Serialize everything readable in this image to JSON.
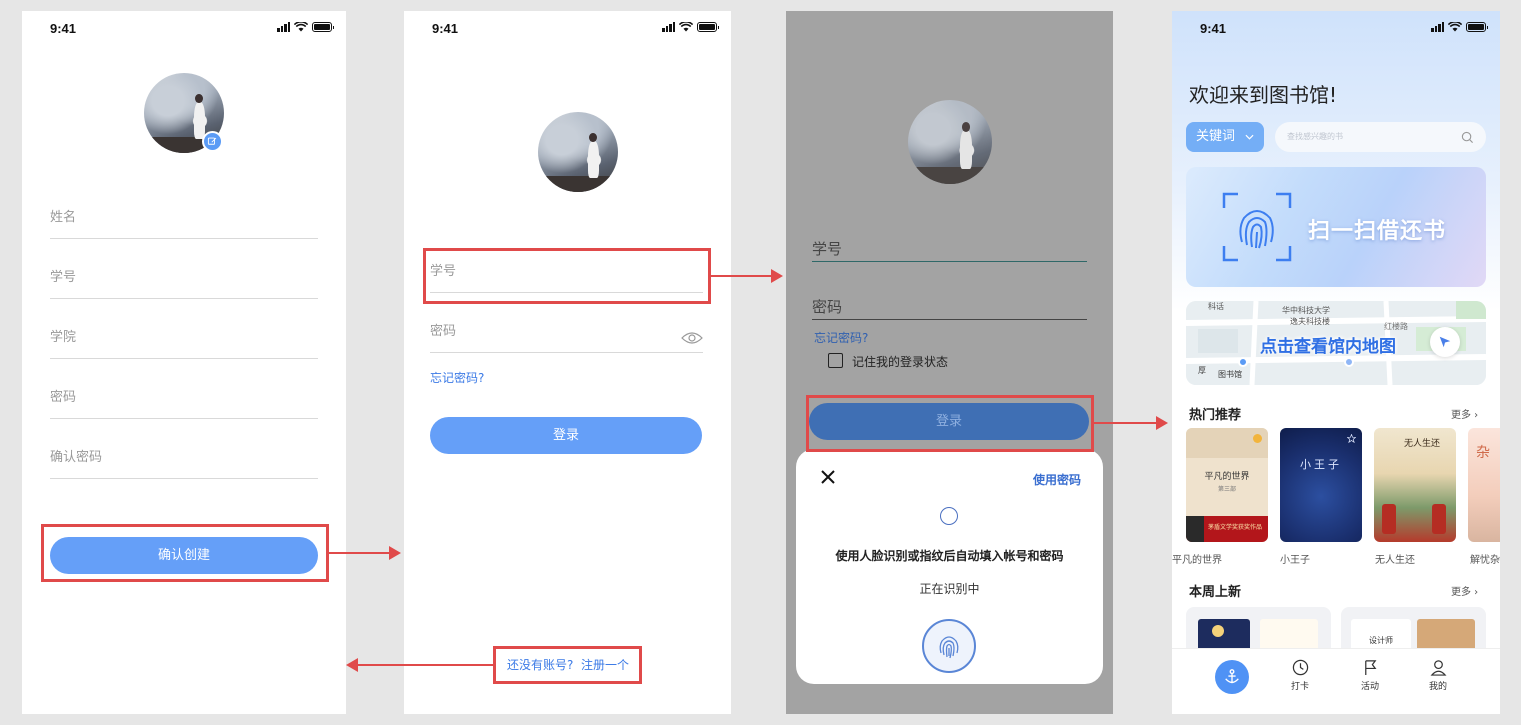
{
  "status": {
    "time": "9:41"
  },
  "register": {
    "fields": [
      "姓名",
      "学号",
      "学院",
      "密码",
      "确认密码"
    ],
    "confirm_button": "确认创建"
  },
  "login": {
    "id_placeholder": "学号",
    "password_placeholder": "密码",
    "forgot_link": "忘记密码?",
    "login_button": "登录",
    "register_link": "还没有账号?  注册一个"
  },
  "biometric": {
    "id_placeholder": "学号",
    "password_placeholder": "密码",
    "forgot_link": "忘记密码?",
    "remember_label": "记住我的登录状态",
    "login_button": "登录",
    "use_password": "使用密码",
    "message": "使用人脸识别或指纹后自动填入帐号和密码",
    "status": "正在识别中"
  },
  "home": {
    "welcome": "欢迎来到图书馆!",
    "keyword_select": "关键词",
    "search_placeholder": "查找感兴趣的书",
    "scan_banner": "扫一扫借还书",
    "map_banner": "点击查看馆内地图",
    "map_labels": [
      "科话",
      "华中科技大学",
      "逸夫科技楼",
      "红楼路",
      "图书馆",
      "厚"
    ],
    "hot_title": "热门推荐",
    "more": "更多",
    "hot_books": [
      {
        "name": "平凡的世界",
        "cover_title": "平凡的世界",
        "cover_sub": "第三部",
        "cover_band": "茅盾文学奖获奖作品"
      },
      {
        "name": "小王子",
        "cover_title": "小王子"
      },
      {
        "name": "无人生还",
        "cover_title": "无人生还"
      },
      {
        "name": "解忧杂",
        "cover_title": "杂"
      }
    ],
    "new_title": "本周上新",
    "new_books": [
      "设计师"
    ],
    "tabs": [
      {
        "label": "",
        "icon": "home-anchor-icon",
        "active": true
      },
      {
        "label": "打卡",
        "icon": "clock-icon"
      },
      {
        "label": "活动",
        "icon": "flag-icon"
      },
      {
        "label": "我的",
        "icon": "user-icon"
      }
    ]
  },
  "colors": {
    "primary": "#659ff8",
    "highlight": "#e04a4a",
    "link": "#3b7ae6"
  }
}
